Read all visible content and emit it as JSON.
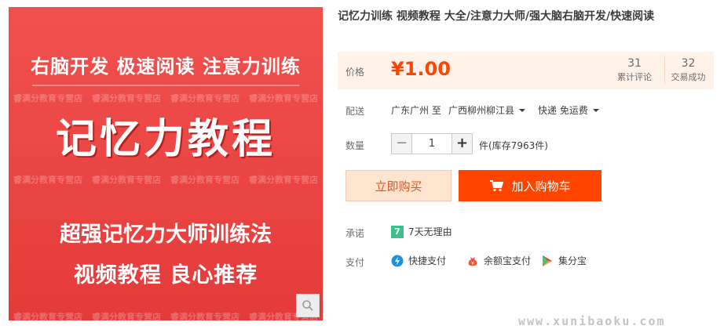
{
  "gallery": {
    "line1": "右脑开发 极速阅读 注意力训练",
    "big_title": "记忆力教程",
    "line3": "超强记忆力大师训练法",
    "line4": "视频教程 良心推荐",
    "watermark": "睿满分教育专营店",
    "zoom_icon": "magnifier-icon"
  },
  "product": {
    "title": "记忆力训练 视频教程 大全/注意力大师/强大脑右脑开发/快速阅读"
  },
  "price": {
    "label": "价格",
    "value": "¥1.00",
    "reviews_count": "31",
    "reviews_label": "累计评论",
    "sold_count": "32",
    "sold_label": "交易成功"
  },
  "shipping": {
    "label": "配送",
    "from": "广东广州 至",
    "to": "广西柳州柳江县",
    "method": "快递 免运费"
  },
  "quantity": {
    "label": "数量",
    "minus": "−",
    "value": "1",
    "plus": "+",
    "stock": "件(库存7963件)"
  },
  "buttons": {
    "buy_now": "立即购买",
    "add_cart": "加入购物车"
  },
  "promise": {
    "label": "承诺",
    "badge": "7",
    "text": "7天无理由"
  },
  "payment": {
    "label": "支付",
    "methods": [
      "快捷支付",
      "余额宝支付",
      "集分宝"
    ]
  },
  "colors": {
    "accent": "#ff4400",
    "price_bg": "#fff2e8",
    "gallery_red": "#e43b3a"
  },
  "site_watermark": "www.xunibaoku.com"
}
